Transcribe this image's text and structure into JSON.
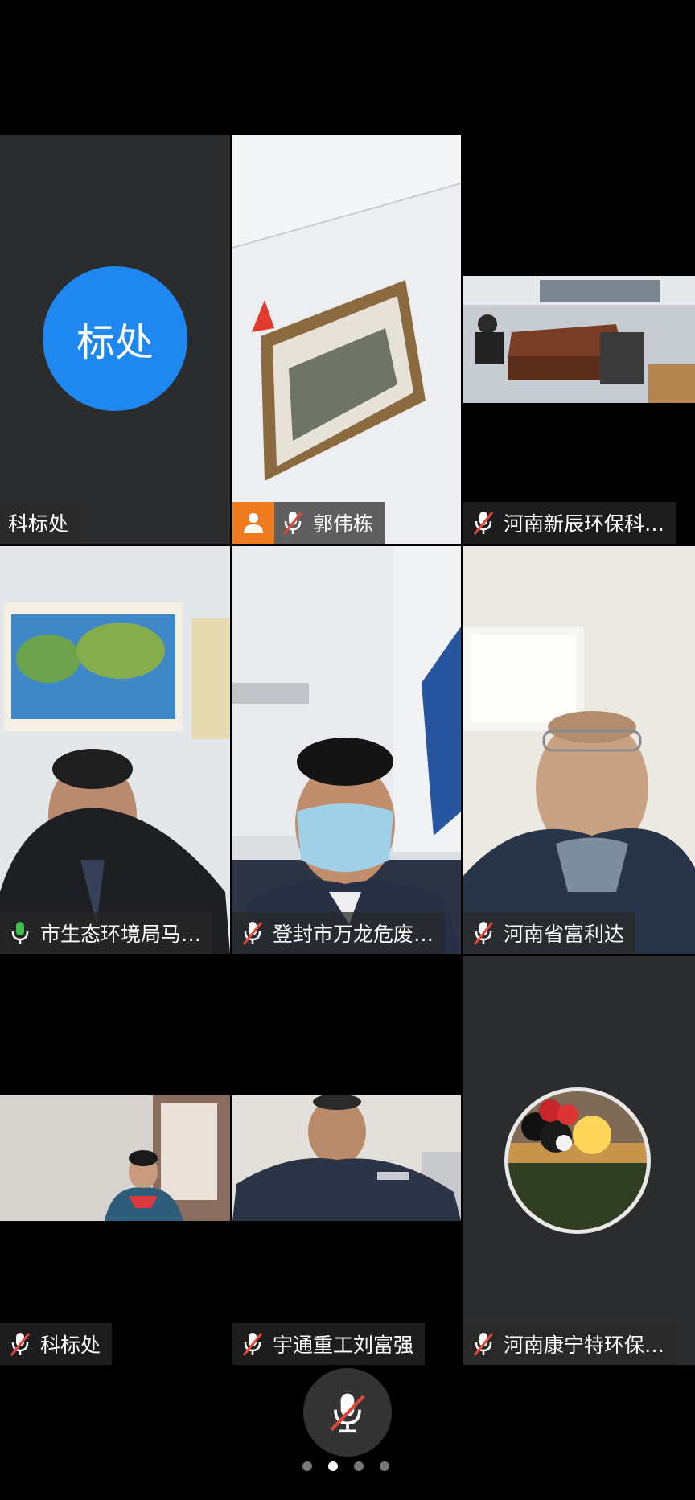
{
  "participants": [
    {
      "avatar_text": "标处",
      "name": "科标处"
    },
    {
      "name": "郭伟栋"
    },
    {
      "name": "河南新辰环保科…"
    },
    {
      "name": "市生态环境局马…"
    },
    {
      "name": "登封市万龙危废…"
    },
    {
      "name": "河南省富利达"
    },
    {
      "name": "科标处"
    },
    {
      "name": "宇通重工刘富强"
    },
    {
      "name": "河南康宁特环保…"
    }
  ],
  "colors": {
    "avatar_blue": "#1f87f0",
    "speaking_border": "#3fbf4f",
    "host_orange": "#f07a1f",
    "muted_red": "#e0463a"
  },
  "pager": {
    "pages": 4,
    "current": 2
  }
}
